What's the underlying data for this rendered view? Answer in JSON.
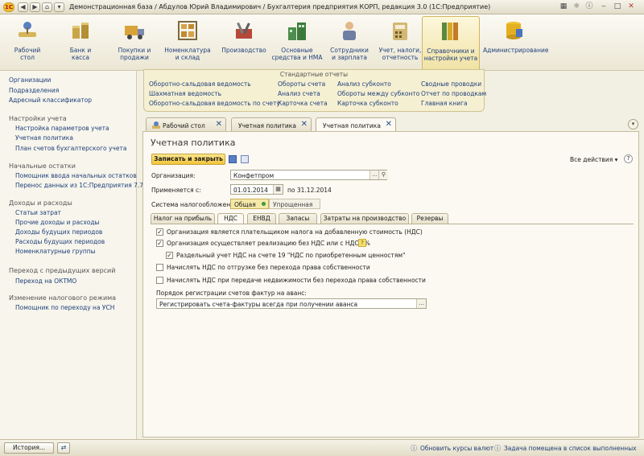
{
  "window": {
    "title": "Демонстрационная база / Абдулов Юрий Владимирович / Бухгалтерия предприятия КОРП, редакция 3.0  (1С:Предприятие)",
    "logo": "1С"
  },
  "sections": [
    {
      "label": "Рабочий\nстол",
      "icon": "desk-icon"
    },
    {
      "label": "Банк и\nкасса",
      "icon": "coins-icon"
    },
    {
      "label": "Покупки и\nпродажи",
      "icon": "truck-icon"
    },
    {
      "label": "Номенклатура\nи склад",
      "icon": "shelves-icon"
    },
    {
      "label": "Производство",
      "icon": "tools-icon"
    },
    {
      "label": "Основные\nсредства и НМА",
      "icon": "buildings-icon"
    },
    {
      "label": "Сотрудники\nи зарплата",
      "icon": "person-icon"
    },
    {
      "label": "Учет, налоги,\nотчетность",
      "icon": "calculator-icon"
    },
    {
      "label": "Справочники и\nнастройки учета",
      "icon": "binders-icon"
    },
    {
      "label": "Администрирование",
      "icon": "database-icon"
    }
  ],
  "reports": {
    "header": "Стандартные отчеты",
    "items": [
      "Оборотно-сальдовая ведомость",
      "Шахматная ведомость",
      "Оборотно-сальдовая ведомость по счету",
      "Обороты счета",
      "Анализ счета",
      "Карточка счета",
      "Анализ субконто",
      "Обороты между субконто",
      "Карточка субконто",
      "Сводные проводки",
      "Отчет по проводкам",
      "Главная книга"
    ]
  },
  "leftnav": {
    "top": [
      "Организации",
      "Подразделения",
      "Адресный классификатор"
    ],
    "groups": [
      {
        "title": "Настройки учета",
        "items": [
          "Настройка параметров учета",
          "Учетная политика",
          "План счетов бухгалтерского учета"
        ]
      },
      {
        "title": "Начальные остатки",
        "items": [
          "Помощник ввода начальных остатков",
          "Перенос данных из 1С:Предприятия 7.7"
        ]
      },
      {
        "title": "Доходы и расходы",
        "items": [
          "Статьи затрат",
          "Прочие доходы и расходы",
          "Доходы будущих периодов",
          "Расходы будущих периодов",
          "Номенклатурные группы"
        ]
      },
      {
        "title": "Переход с предыдущих версий",
        "items": [
          "Переход на ОКТМО"
        ]
      },
      {
        "title": "Изменение налогового режима",
        "items": [
          "Помощник по переходу на УСН"
        ]
      }
    ]
  },
  "tabs": [
    {
      "label": "Рабочий стол"
    },
    {
      "label": "Учетная политика"
    },
    {
      "label": "Учетная политика"
    }
  ],
  "form": {
    "title": "Учетная политика",
    "save_close_label": "Записать и закрыть",
    "all_actions_label": "Все действия ▾",
    "help_label": "?",
    "org_label": "Организация:",
    "org_value": "Конфетпром",
    "applies_label": "Применяется с:",
    "applies_value": "01.01.2014",
    "applies_to": "по 31.12.2014",
    "tax_system_label": "Система налогообложения:",
    "tax_options": [
      "Общая",
      "Упрощенная"
    ],
    "content_tabs": [
      "Налог на прибыль",
      "НДС",
      "ЕНВД",
      "Запасы",
      "Затраты на производство",
      "Резервы"
    ],
    "checkboxes": [
      {
        "label": "Организация является плательщиком налога на добавленную стоимость (НДС)",
        "checked": true
      },
      {
        "label": "Организация осуществляет реализацию без НДС или с НДС 0%",
        "checked": true
      },
      {
        "label": "Раздельный учет НДС на счете 19 \"НДС по приобретенным ценностям\"",
        "checked": true
      },
      {
        "label": "Начислять НДС по отгрузке без перехода права собственности",
        "checked": false
      },
      {
        "label": "Начислять НДС при передаче недвижимости без перехода права собственности",
        "checked": false
      }
    ],
    "invoice_order_label": "Порядок регистрации счетов фактур на аванс:",
    "invoice_order_value": "Регистрировать счета-фактуры всегда при получении аванса"
  },
  "statusbar": {
    "history_label": "История...",
    "msg1": "Обновить курсы валют",
    "msg2": "Задача помещена в список выполненных"
  },
  "colors": {
    "accent": "#f4c63c",
    "link": "#1f3f7a",
    "panel": "#f6f0d3"
  }
}
